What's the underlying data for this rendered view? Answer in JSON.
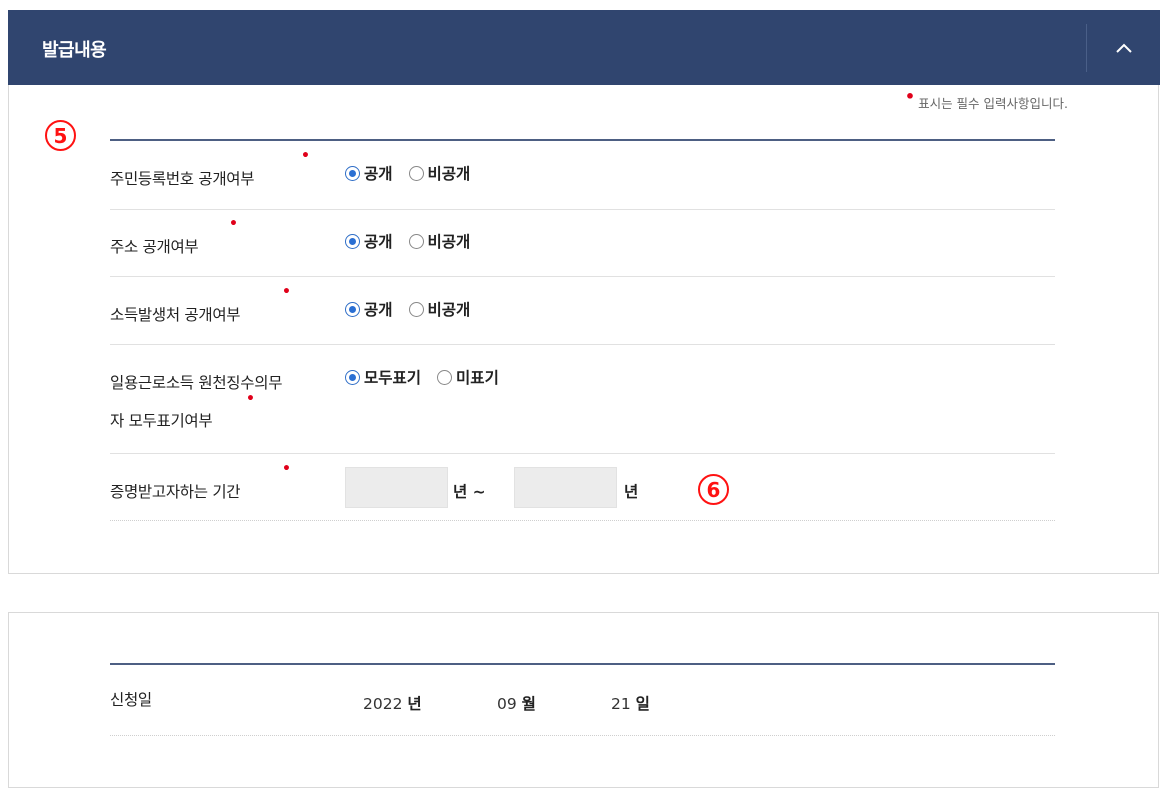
{
  "section": {
    "title": "발급내용",
    "collapse_icon": "chevron-up-icon"
  },
  "required_note": "표시는 필수 입력사항입니다.",
  "markers": {
    "five": "5",
    "six": "6"
  },
  "rows": [
    {
      "label": "주민등록번호 공개여부",
      "options": [
        "공개",
        "비공개"
      ],
      "selected": 0
    },
    {
      "label": "주소 공개여부",
      "options": [
        "공개",
        "비공개"
      ],
      "selected": 0
    },
    {
      "label": "소득발생처 공개여부",
      "options": [
        "공개",
        "비공개"
      ],
      "selected": 0
    },
    {
      "label_line1": "일용근로소득 원천징수의무",
      "label_line2": "자 모두표기여부",
      "options": [
        "모두표기",
        "미표기"
      ],
      "selected": 0
    }
  ],
  "period": {
    "label": "증명받고자하는 기간",
    "from_value": "",
    "to_value": "",
    "from_unit": "년 ~",
    "to_unit": "년"
  },
  "application_date": {
    "label": "신청일",
    "year": "2022",
    "year_unit": "년",
    "month": "09",
    "month_unit": "월",
    "day": "21",
    "day_unit": "일"
  },
  "colors": {
    "header_bg": "#30456f",
    "required": "#e0001a",
    "marker": "#ff1212",
    "radio": "#2a6fd3"
  }
}
